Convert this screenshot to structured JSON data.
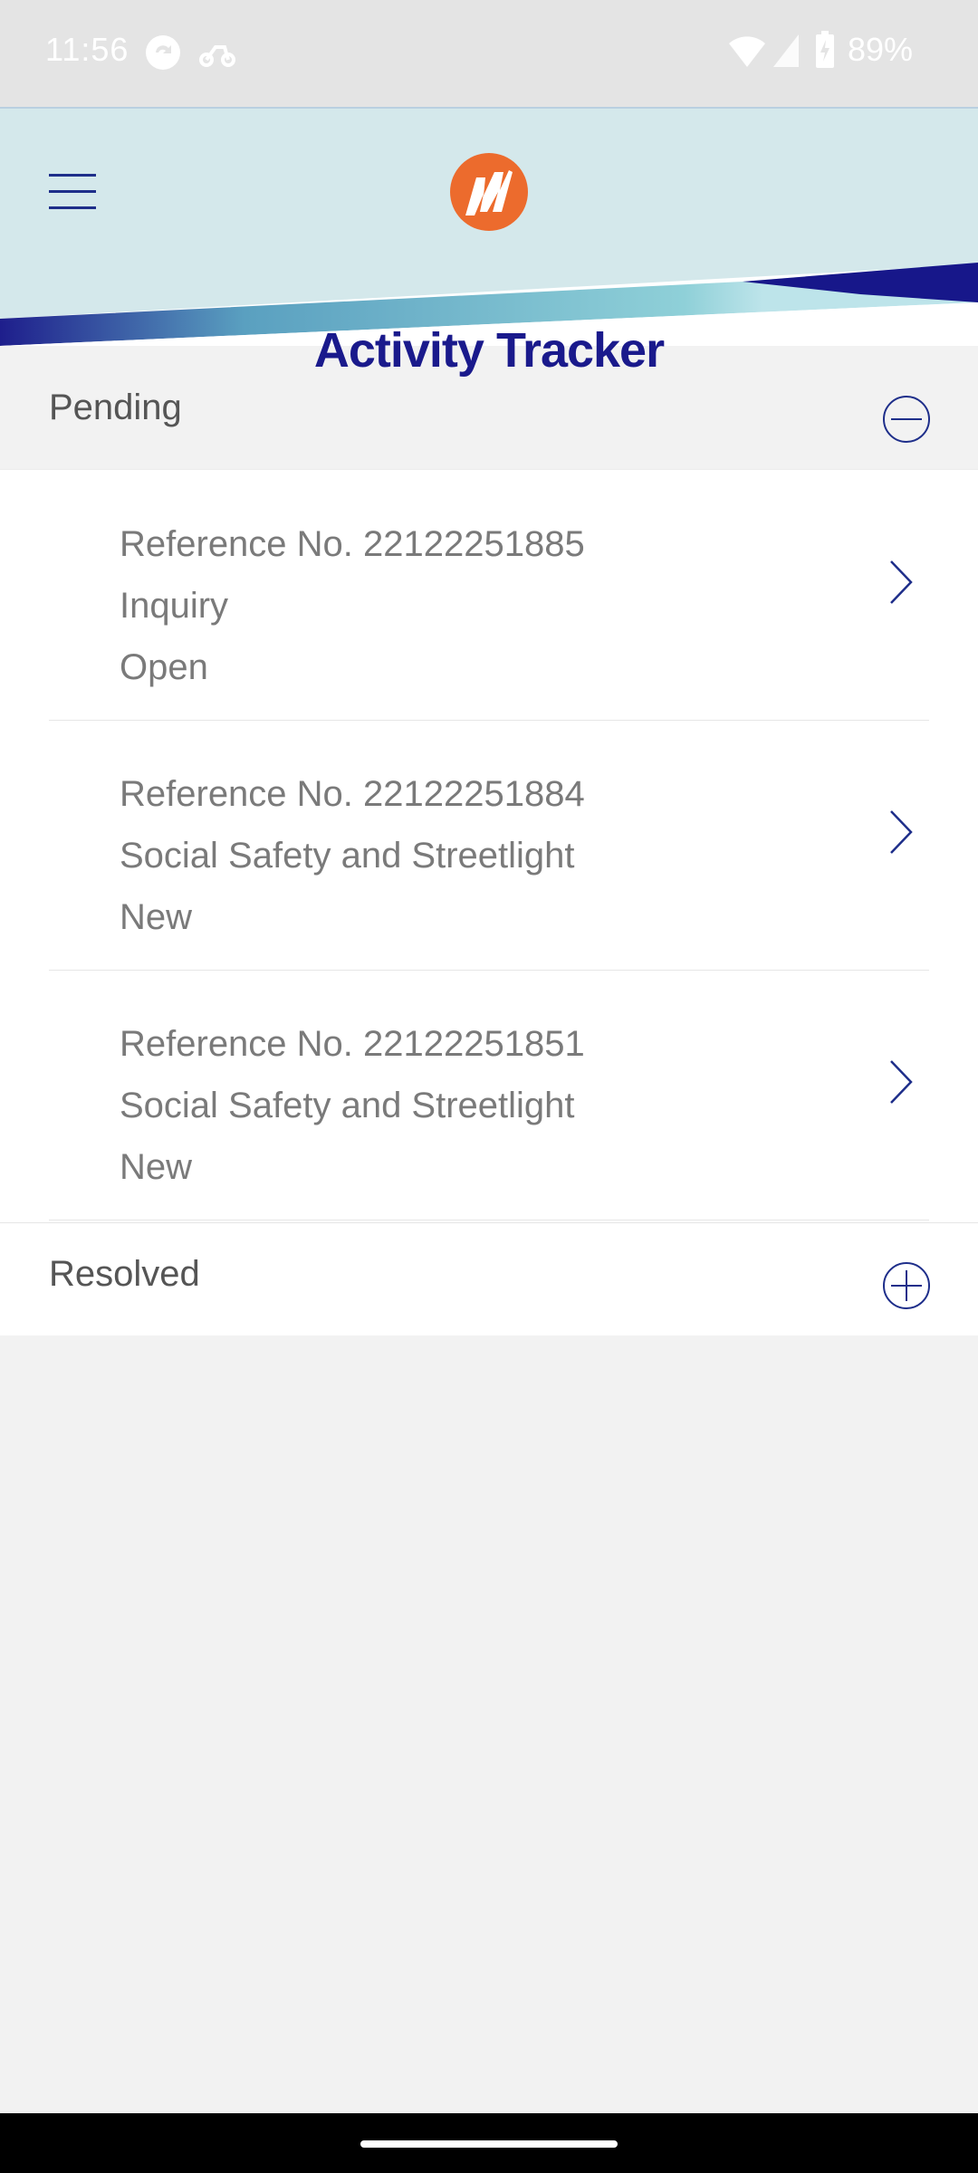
{
  "status_bar": {
    "time": "11:56",
    "battery": "89%",
    "icons": [
      "sync-icon",
      "scooter-icon",
      "wifi-icon",
      "signal-icon",
      "battery-icon"
    ]
  },
  "header": {
    "menu_icon": "hamburger-menu-icon",
    "logo": "meralco-logo",
    "title": "Activity Tracker"
  },
  "pending": {
    "label": "Pending",
    "toggle_icon": "collapse-minus-icon",
    "items": [
      {
        "reference": "Reference No. 22122251885",
        "category": "Inquiry",
        "status": "Open"
      },
      {
        "reference": "Reference No. 22122251884",
        "category": "Social Safety and Streetlight",
        "status": "New"
      },
      {
        "reference": "Reference No. 22122251851",
        "category": "Social Safety and Streetlight",
        "status": "New"
      }
    ]
  },
  "resolved": {
    "label": "Resolved",
    "toggle_icon": "expand-plus-icon"
  },
  "colors": {
    "accent_navy": "#1a1a8c",
    "logo_orange": "#ec6b2d",
    "header_bg": "#d4e8eb",
    "page_bg": "#f2f2f2"
  }
}
